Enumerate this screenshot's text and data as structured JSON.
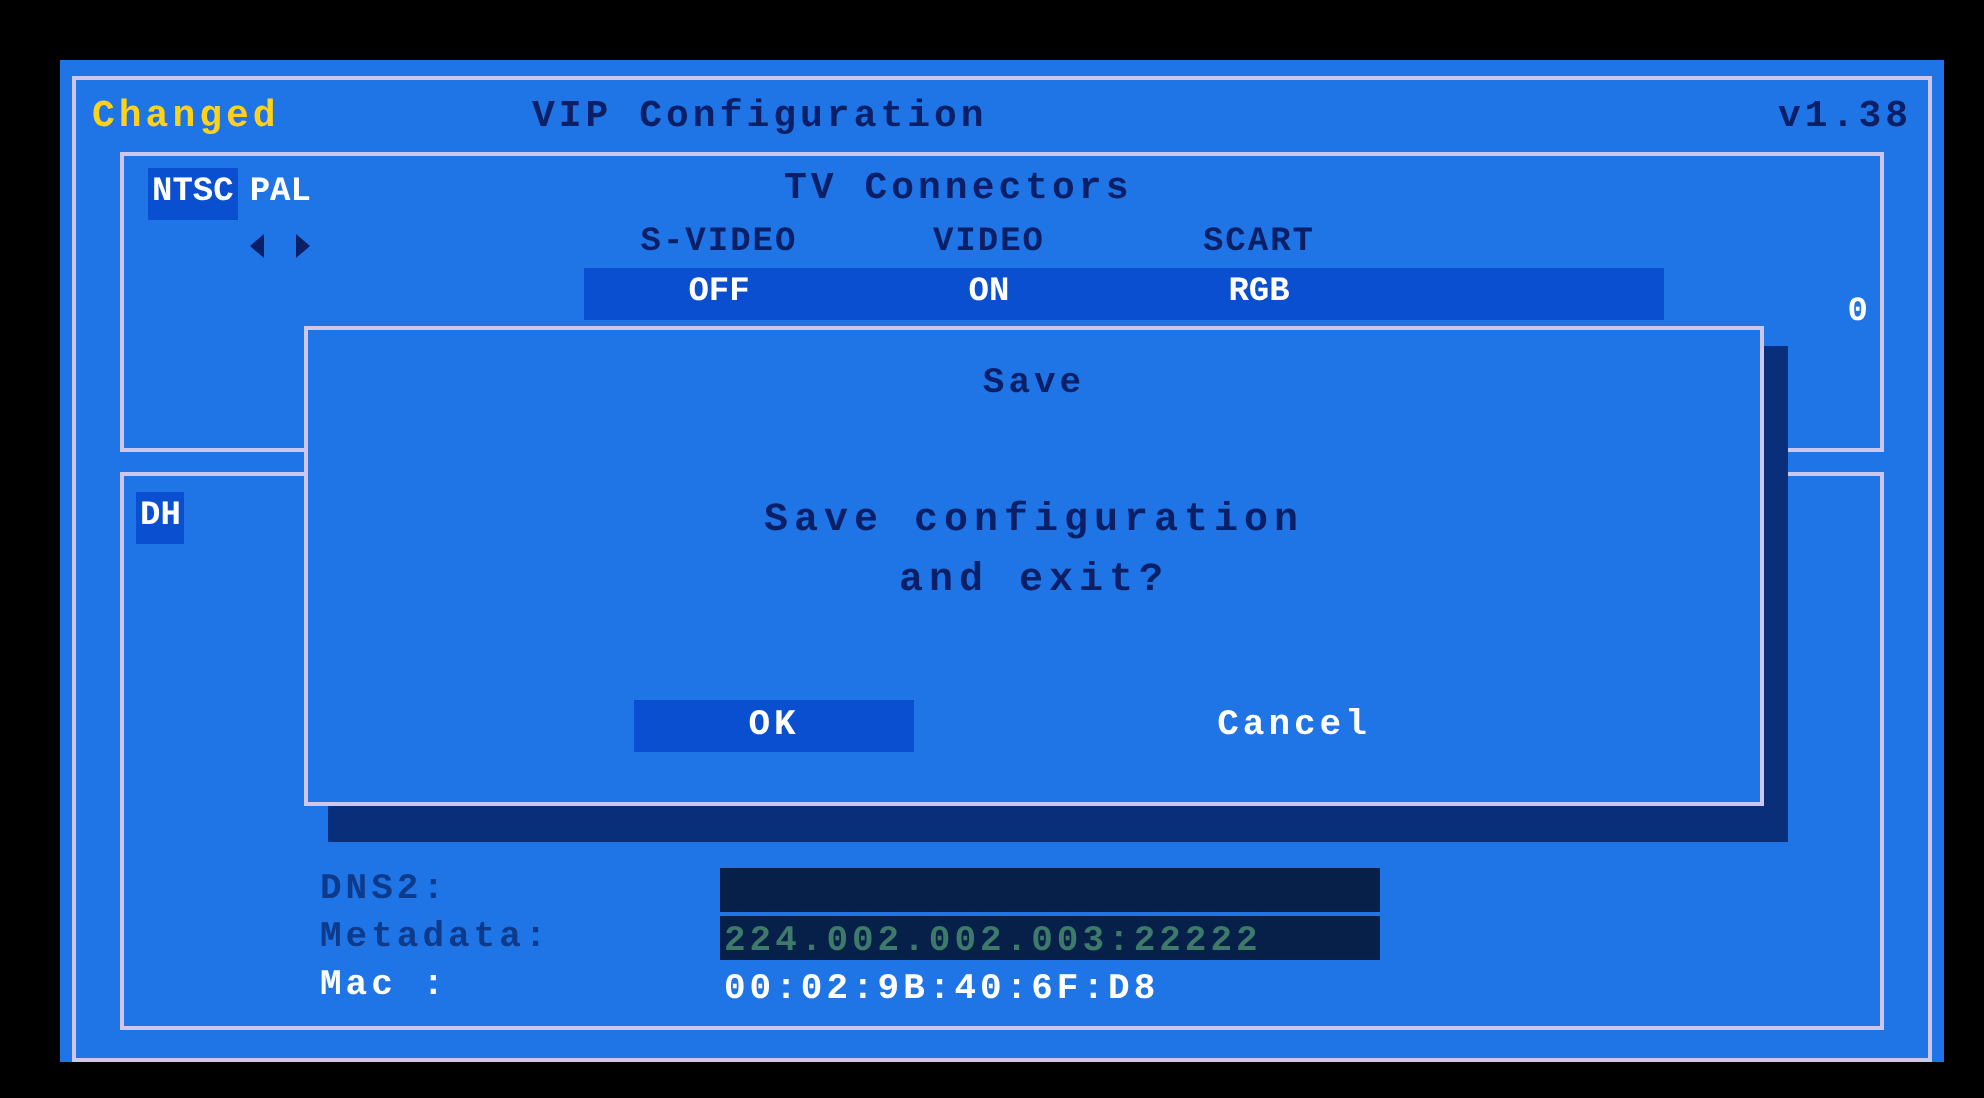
{
  "header": {
    "status": "Changed",
    "title": "VIP Configuration",
    "version": "v1.38"
  },
  "standard": {
    "options": [
      {
        "label": "NTSC",
        "selected": true
      },
      {
        "label": "PAL",
        "selected": false
      }
    ]
  },
  "connectors": {
    "title": "TV Connectors",
    "fragment": "0",
    "columns": [
      {
        "label": "S-VIDEO",
        "value": "OFF"
      },
      {
        "label": "VIDEO",
        "value": "ON"
      },
      {
        "label": "SCART",
        "value": "RGB"
      }
    ]
  },
  "network": {
    "tab": "DH",
    "fields": [
      {
        "label": "DNS2:",
        "disabled": true
      },
      {
        "label": "Metadata:",
        "value": "224.002.002.003:22222",
        "disabled": true
      },
      {
        "label": "Mac :",
        "value": "00:02:9B:40:6F:D8",
        "disabled": false
      }
    ]
  },
  "dialog": {
    "title": "Save",
    "lines": [
      "Save configuration",
      "and exit?"
    ],
    "buttons": [
      {
        "label": "OK",
        "selected": true
      },
      {
        "label": "Cancel",
        "selected": false
      }
    ]
  }
}
